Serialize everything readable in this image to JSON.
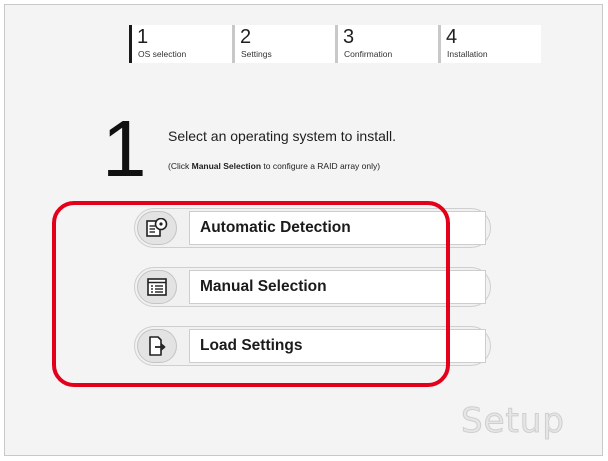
{
  "stepper": {
    "steps": [
      {
        "number": "1",
        "label": "OS selection"
      },
      {
        "number": "2",
        "label": "Settings"
      },
      {
        "number": "3",
        "label": "Confirmation"
      },
      {
        "number": "4",
        "label": "Installation"
      }
    ],
    "active_step": 1
  },
  "main": {
    "step_number": "1",
    "instruction": "Select an operating system to install.",
    "note_prefix": "(Click ",
    "note_bold": "Manual Selection",
    "note_suffix": " to configure a RAID array only)"
  },
  "options": [
    {
      "label": "Automatic Detection",
      "icon": "disc-drive-icon"
    },
    {
      "label": "Manual Selection",
      "icon": "list-icon"
    },
    {
      "label": "Load Settings",
      "icon": "load-file-icon"
    }
  ],
  "branding": {
    "text": "Setup"
  },
  "colors": {
    "highlight": "#e2001a",
    "background": "#f4f4f4"
  }
}
